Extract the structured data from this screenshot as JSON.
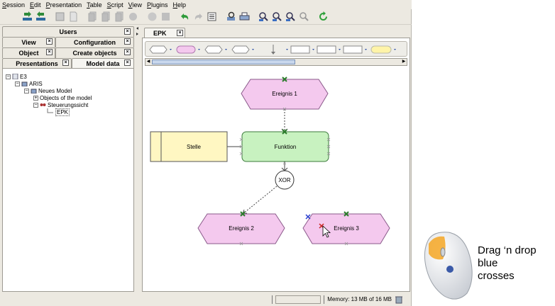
{
  "menubar": {
    "items": [
      "Session",
      "Edit",
      "Presentation",
      "Table",
      "Script",
      "View",
      "Plugins",
      "Help"
    ]
  },
  "left_panel": {
    "tabs_row1": [
      {
        "label": "Users"
      }
    ],
    "tabs_row2": [
      {
        "label": "View"
      },
      {
        "label": "Configuration"
      }
    ],
    "tabs_row3": [
      {
        "label": "Object"
      },
      {
        "label": "Create objects"
      }
    ],
    "tabs_row4": [
      {
        "label": "Presentations"
      },
      {
        "label": "Model data"
      }
    ],
    "active_tab": "Model data",
    "tree": [
      {
        "label": "E3",
        "level": 0,
        "expander": "−"
      },
      {
        "label": "ARIS",
        "level": 1,
        "expander": "−"
      },
      {
        "label": "Neues Model",
        "level": 2,
        "expander": "−"
      },
      {
        "label": "Objects of the model",
        "level": 3,
        "expander": "+"
      },
      {
        "label": "Steuerungssicht",
        "level": 3,
        "expander": "−"
      },
      {
        "label": "EPK",
        "level": 4,
        "expander": ""
      }
    ]
  },
  "editor": {
    "tab_label": "EPK",
    "diagram": {
      "nodes": {
        "ereignis1": "Ereignis 1",
        "funktion": "Funktion",
        "stelle": "Stelle",
        "xor": "XOR",
        "ereignis2": "Ereignis 2",
        "ereignis3": "Ereignis 3"
      }
    }
  },
  "statusbar": {
    "memory": "Memory: 13 MB of 16 MB"
  },
  "annotation": {
    "lines": [
      "Drag ‘n drop",
      "blue",
      "crosses"
    ]
  },
  "colors": {
    "event_fill": "#f4c9ee",
    "function_fill": "#c8f2c0",
    "org_fill": "#fff7c2",
    "handle_green": "#2b7d2b",
    "handle_blue": "#2a3fd1"
  }
}
